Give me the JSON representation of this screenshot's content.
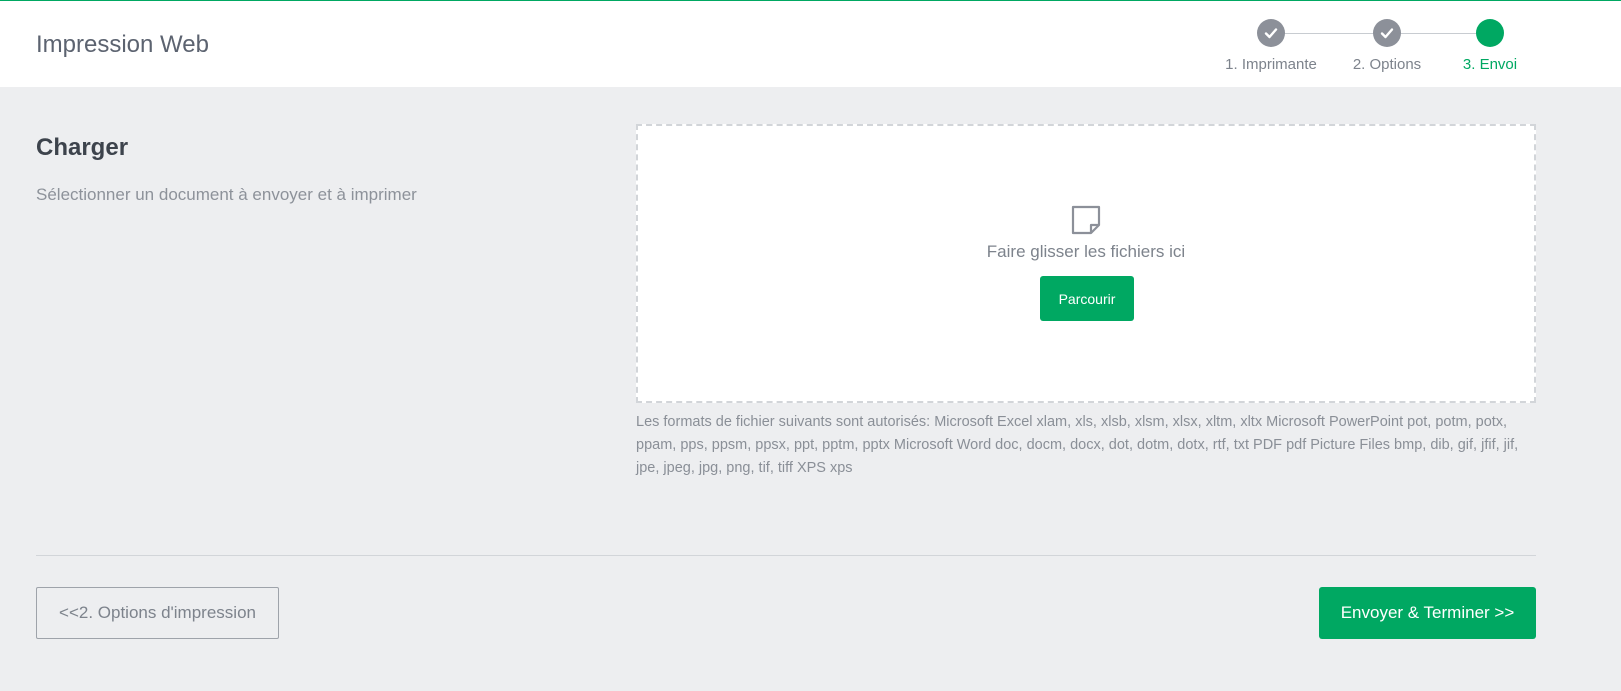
{
  "header": {
    "title": "Impression Web"
  },
  "stepper": {
    "steps": [
      {
        "label": "1. Imprimante",
        "state": "done"
      },
      {
        "label": "2. Options",
        "state": "done"
      },
      {
        "label": "3. Envoi",
        "state": "active"
      }
    ]
  },
  "upload": {
    "title": "Charger",
    "description": "Sélectionner un document à envoyer et à imprimer",
    "dropzone_text": "Faire glisser les fichiers ici",
    "browse_label": "Parcourir",
    "formats_text": "Les formats de fichier suivants sont autorisés: Microsoft Excel xlam, xls, xlsb, xlsm, xlsx, xltm, xltx Microsoft PowerPoint pot, potm, potx, ppam, pps, ppsm, ppsx, ppt, pptm, pptx Microsoft Word doc, docm, docx, dot, dotm, dotx, rtf, txt PDF pdf Picture Files bmp, dib, gif, jfif, jif, jpe, jpeg, jpg, png, tif, tiff XPS xps"
  },
  "footer": {
    "back_label": "<<2. Options d'impression",
    "finish_label": "Envoyer & Terminer >>"
  },
  "colors": {
    "accent": "#00a862",
    "done_step": "#8c9099",
    "background": "#edeef0"
  },
  "icons": {
    "step_done": "checkmark-icon",
    "dropzone": "file-icon"
  }
}
